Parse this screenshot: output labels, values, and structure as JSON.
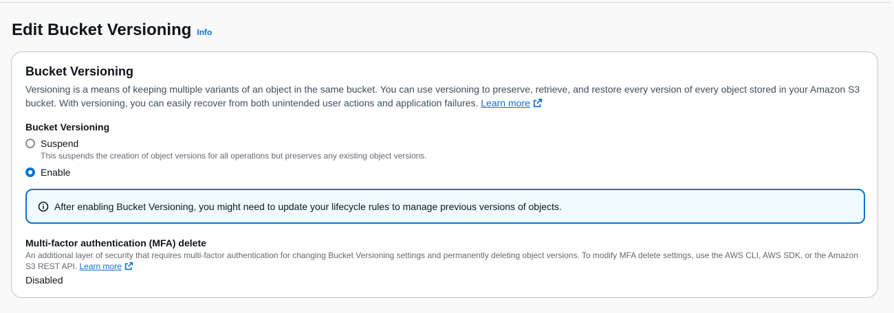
{
  "header": {
    "title": "Edit Bucket Versioning",
    "info_link": "Info"
  },
  "versioning": {
    "section_title": "Bucket Versioning",
    "description": "Versioning is a means of keeping multiple variants of an object in the same bucket. You can use versioning to preserve, retrieve, and restore every version of every object stored in your Amazon S3 bucket. With versioning, you can easily recover from both unintended user actions and application failures.",
    "learn_more": "Learn more",
    "field_label": "Bucket Versioning",
    "options": [
      {
        "label": "Suspend",
        "description": "This suspends the creation of object versions for all operations but preserves any existing object versions.",
        "selected": false
      },
      {
        "label": "Enable",
        "description": "",
        "selected": true
      }
    ],
    "alert_text": "After enabling Bucket Versioning, you might need to update your lifecycle rules to manage previous versions of objects."
  },
  "mfa": {
    "title": "Multi-factor authentication (MFA) delete",
    "description": "An additional layer of security that requires multi-factor authentication for changing Bucket Versioning settings and permanently deleting object versions. To modify MFA delete settings, use the AWS CLI, AWS SDK, or the Amazon S3 REST API.",
    "learn_more": "Learn more",
    "value": "Disabled"
  },
  "colors": {
    "link": "#0972d3",
    "alert_background": "#f0fbff",
    "alert_border": "#0972d3"
  },
  "icons": {
    "external_link": "external-link-icon",
    "info": "info-circle-icon"
  }
}
